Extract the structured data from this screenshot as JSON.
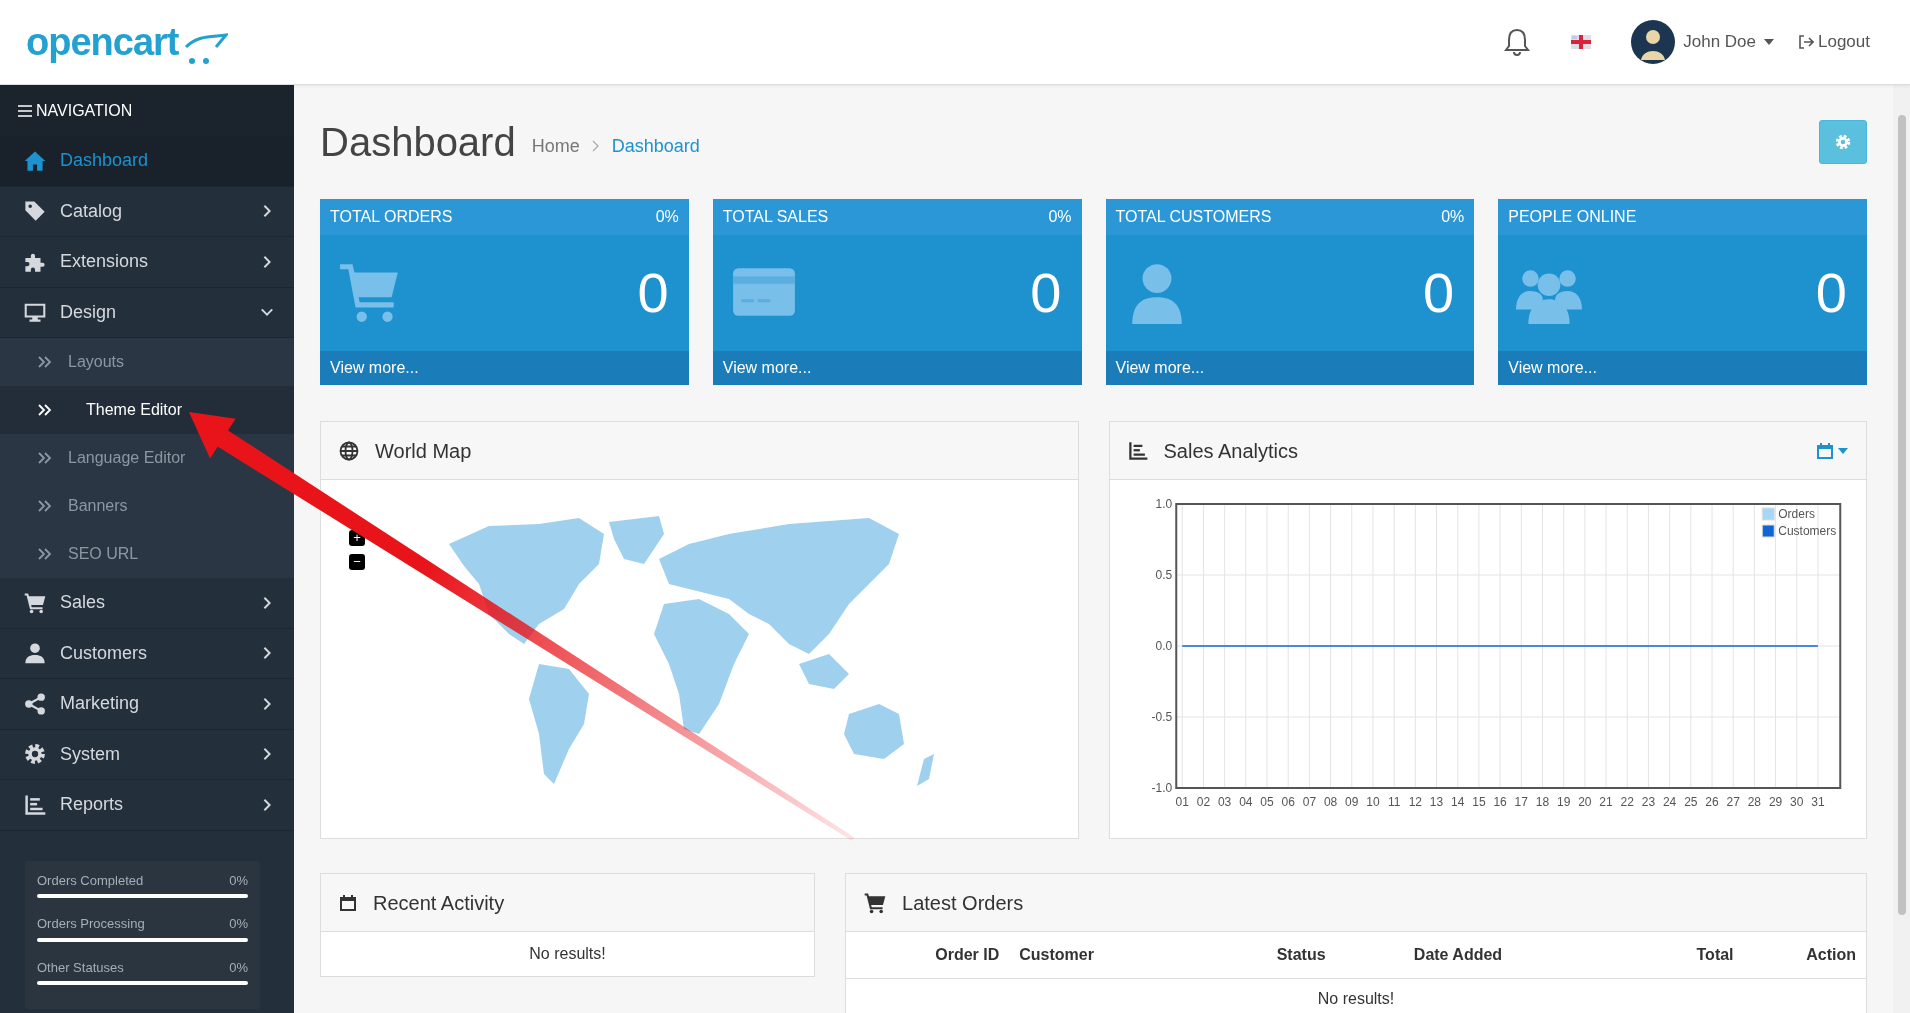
{
  "header": {
    "logo": "opencart",
    "user": "John Doe",
    "logout": "Logout"
  },
  "sidebar": {
    "title": "NAVIGATION",
    "items": [
      {
        "label": "Dashboard",
        "selected": true
      },
      {
        "label": "Catalog",
        "selected": false,
        "expanded": false
      },
      {
        "label": "Extensions",
        "selected": false,
        "expanded": false
      },
      {
        "label": "Design",
        "selected": false,
        "expanded": true,
        "children": [
          {
            "label": "Layouts",
            "selected": false
          },
          {
            "label": "Theme Editor",
            "selected": true
          },
          {
            "label": "Language Editor",
            "selected": false
          },
          {
            "label": "Banners",
            "selected": false
          },
          {
            "label": "SEO URL",
            "selected": false
          }
        ]
      },
      {
        "label": "Sales",
        "selected": false,
        "expanded": false
      },
      {
        "label": "Customers",
        "selected": false,
        "expanded": false
      },
      {
        "label": "Marketing",
        "selected": false,
        "expanded": false
      },
      {
        "label": "System",
        "selected": false,
        "expanded": false
      },
      {
        "label": "Reports",
        "selected": false,
        "expanded": false
      }
    ],
    "stats": [
      {
        "label": "Orders Completed",
        "value": "0%",
        "level": 0
      },
      {
        "label": "Orders Processing",
        "value": "0%",
        "level": 0
      },
      {
        "label": "Other Statuses",
        "value": "0%",
        "level": 0
      }
    ]
  },
  "page": {
    "title": "Dashboard",
    "breadcrumb": [
      {
        "label": "Home",
        "selected": false
      },
      {
        "label": "Dashboard",
        "selected": true
      }
    ]
  },
  "tiles": [
    {
      "title": "TOTAL ORDERS",
      "percent": "0%",
      "value": "0",
      "link": "View more..."
    },
    {
      "title": "TOTAL SALES",
      "percent": "0%",
      "value": "0",
      "link": "View more..."
    },
    {
      "title": "TOTAL CUSTOMERS",
      "percent": "0%",
      "value": "0",
      "link": "View more..."
    },
    {
      "title": "PEOPLE ONLINE",
      "value": "0",
      "link": "View more..."
    }
  ],
  "world_map": {
    "title": "World Map",
    "zoom_buttons": [
      "+",
      "−"
    ]
  },
  "sales_analytics": {
    "title": "Sales Analytics",
    "chart_data": {
      "type": "line",
      "categories": [
        "01",
        "02",
        "03",
        "04",
        "05",
        "06",
        "07",
        "08",
        "09",
        "10",
        "11",
        "12",
        "13",
        "14",
        "15",
        "16",
        "17",
        "18",
        "19",
        "20",
        "21",
        "22",
        "23",
        "24",
        "25",
        "26",
        "27",
        "28",
        "29",
        "30",
        "31"
      ],
      "series": [
        {
          "name": "Orders",
          "color": "#a6d8f5",
          "values": [
            null,
            null,
            null,
            null,
            null,
            null,
            null,
            null,
            null,
            null,
            null,
            null,
            null,
            null,
            null,
            null,
            null,
            null,
            null,
            null,
            null,
            null,
            null,
            null,
            null,
            null,
            null,
            null,
            null,
            null,
            null
          ]
        },
        {
          "name": "Customers",
          "color": "#1065d2",
          "values": [
            0,
            0,
            0,
            0,
            0,
            0,
            0,
            0,
            0,
            0,
            0,
            0,
            0,
            0,
            0,
            0,
            0,
            0,
            0,
            0,
            0,
            0,
            0,
            0,
            0,
            0,
            0,
            0,
            0,
            0,
            0
          ]
        }
      ],
      "ylim": [
        -1,
        1
      ],
      "grid": true,
      "legend": true,
      "yticks": [
        {
          "value": 1,
          "label": "1.0"
        },
        {
          "value": 0.5,
          "label": "0.5"
        },
        {
          "value": 0,
          "label": "0.0"
        },
        {
          "value": -0.5,
          "label": "-0.5"
        },
        {
          "value": -1,
          "label": "-1.0"
        }
      ]
    }
  },
  "recent_activity": {
    "title": "Recent Activity",
    "empty": "No results!"
  },
  "latest_orders": {
    "title": "Latest Orders",
    "columns": [
      "Order ID",
      "Customer",
      "Status",
      "Date Added",
      "Total",
      "Action"
    ],
    "empty": "No results!"
  }
}
